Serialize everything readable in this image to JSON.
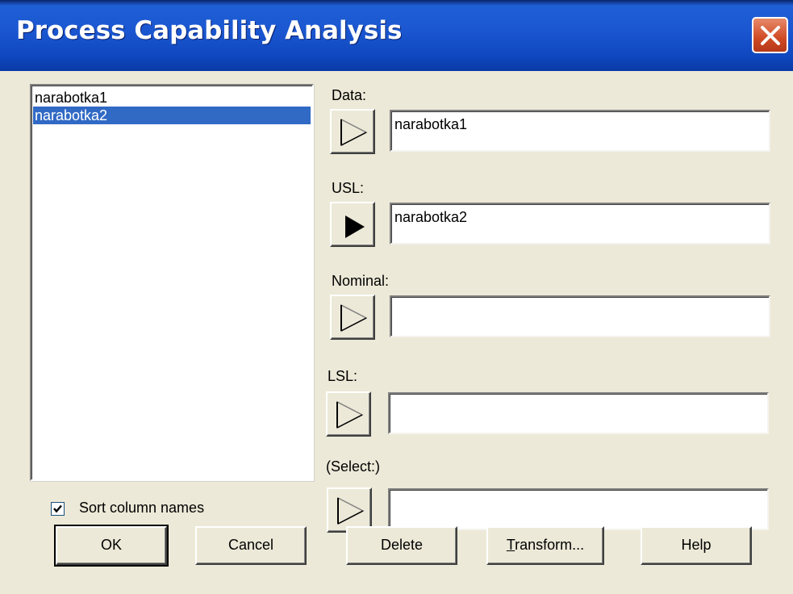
{
  "window": {
    "title": "Process Capability Analysis"
  },
  "list": {
    "items": [
      {
        "label": "narabotka1",
        "selected": false
      },
      {
        "label": "narabotka2",
        "selected": true
      }
    ]
  },
  "sort_checkbox": {
    "label": "Sort column names",
    "checked": true
  },
  "fields": [
    {
      "label": "Data:",
      "value": "narabotka1",
      "arrow_active": false
    },
    {
      "label": "USL:",
      "value": "narabotka2",
      "arrow_active": true
    },
    {
      "label": "Nominal:",
      "value": "",
      "arrow_active": false
    },
    {
      "label": "LSL:",
      "value": "",
      "arrow_active": false
    },
    {
      "label": "(Select:)",
      "value": "",
      "arrow_active": false
    }
  ],
  "buttons": {
    "ok": "OK",
    "cancel": "Cancel",
    "delete": "Delete",
    "transform_mnemonic": "T",
    "transform_rest": "ransform...",
    "help": "Help"
  },
  "colors": {
    "titlebar": "#0f47bf",
    "selection": "#316ac5",
    "face": "#ece9d8"
  },
  "icons": {
    "close": "close-icon",
    "arrow": "arrow-right-icon"
  }
}
